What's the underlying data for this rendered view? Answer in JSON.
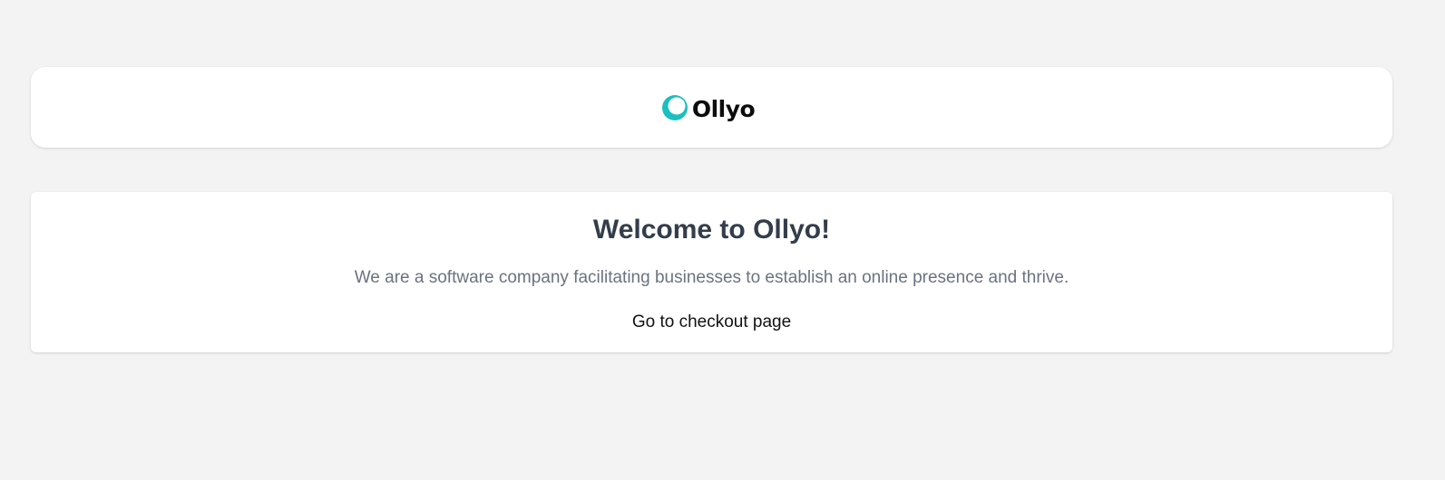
{
  "header": {
    "brand_name": "Ollyo",
    "logo_icon": "ollyo-ring-logo-icon",
    "logo_color": "#1bbfbf"
  },
  "welcome": {
    "title": "Welcome to Ollyo!",
    "description": "We are a software company facilitating businesses to establish an online presence and thrive.",
    "checkout_link_label": "Go to checkout page"
  }
}
